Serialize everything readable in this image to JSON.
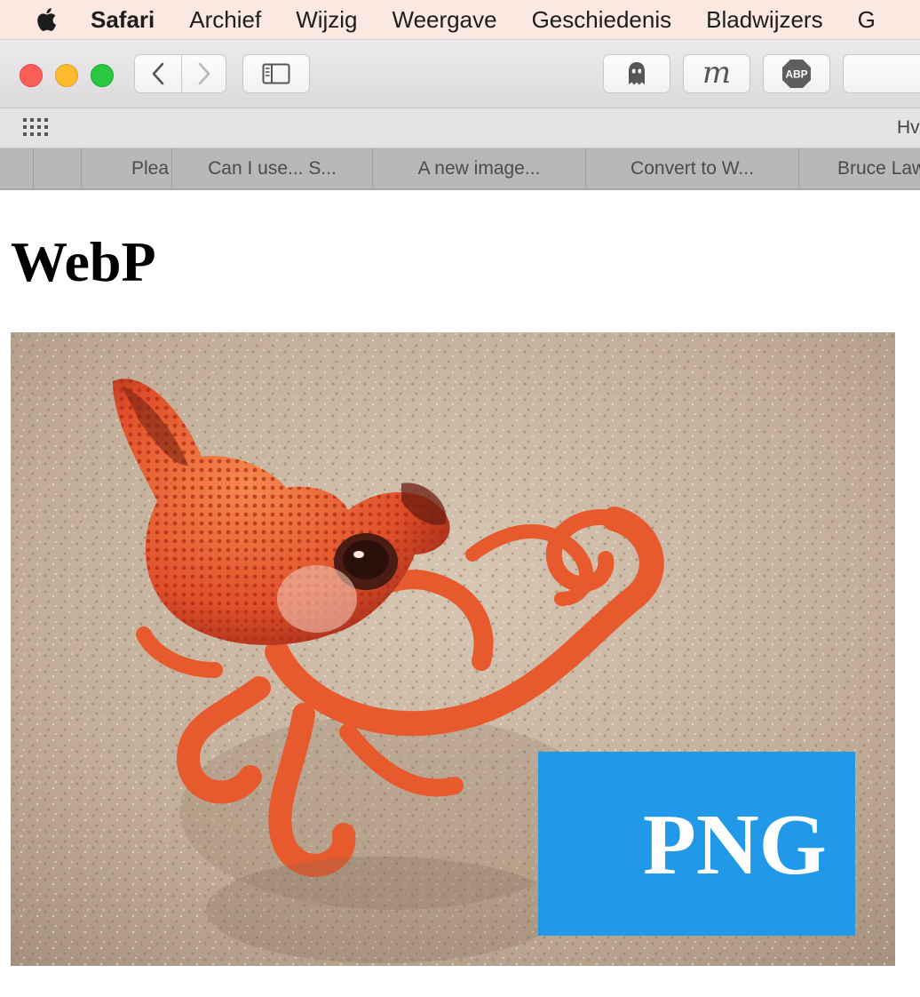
{
  "menubar": {
    "app_name": "Safari",
    "items": [
      "Archief",
      "Wijzig",
      "Weergave",
      "Geschiedenis",
      "Bladwijzers",
      "G"
    ]
  },
  "toolbar": {
    "extensions": [
      {
        "icon": "ghost-icon",
        "label": ""
      },
      {
        "icon": "m-script-icon",
        "label": "m"
      },
      {
        "icon": "adblock-icon",
        "label": "ABP"
      }
    ]
  },
  "favorites": {
    "visible_text": "Hv"
  },
  "tabs": [
    {
      "label": ""
    },
    {
      "label": ""
    },
    {
      "label": "Plea"
    },
    {
      "label": "Can I use... S..."
    },
    {
      "label": "A new image..."
    },
    {
      "label": "Convert to W..."
    },
    {
      "label": "Bruce Law"
    }
  ],
  "page": {
    "title": "WebP",
    "image_badge": "PNG"
  },
  "colors": {
    "menubar_bg": "#fbe9e1",
    "close": "#fc5f57",
    "minimize": "#fdbc2e",
    "zoom": "#28c840",
    "badge_blue": "#2299e8"
  }
}
